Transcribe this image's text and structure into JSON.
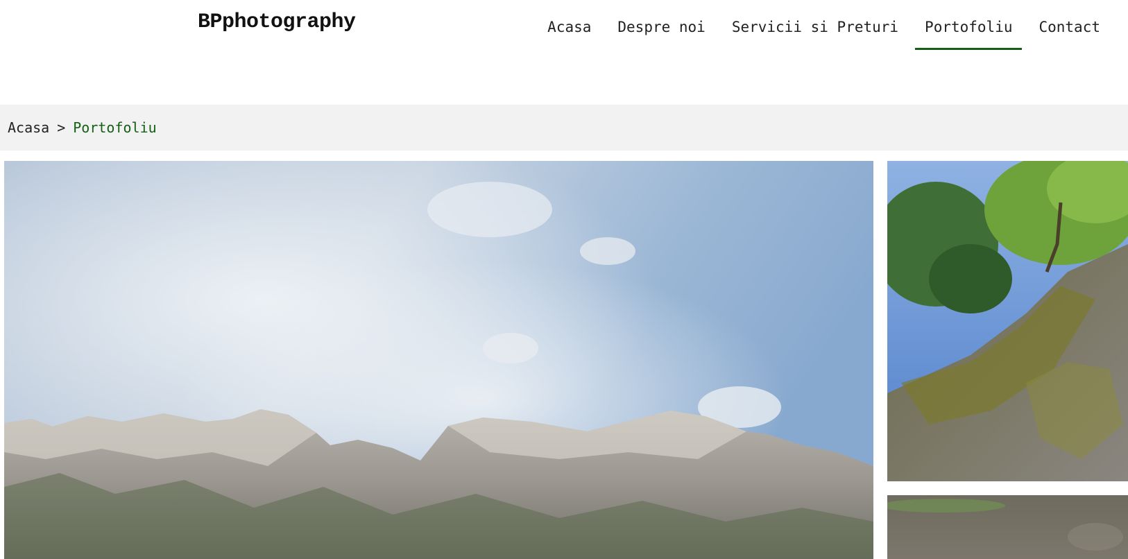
{
  "header": {
    "logo_text": "BPphotography",
    "nav": [
      {
        "label": "Acasa",
        "active": false
      },
      {
        "label": "Despre noi",
        "active": false
      },
      {
        "label": "Servicii si Preturi",
        "active": false
      },
      {
        "label": "Portofoliu",
        "active": true
      },
      {
        "label": "Contact",
        "active": false
      }
    ]
  },
  "breadcrumb": {
    "home": "Acasa",
    "separator": ">",
    "current": "Portofoliu"
  },
  "gallery": {
    "photos": [
      {
        "subject": "mountain-ridge-under-cloudy-sky"
      },
      {
        "subject": "mossy-tree-bark-with-green-leaves"
      },
      {
        "subject": "blurred-soil-field"
      }
    ]
  },
  "colors": {
    "accent": "#135f13",
    "breadcrumb_bg": "#f2f2f2",
    "text": "#222222"
  }
}
